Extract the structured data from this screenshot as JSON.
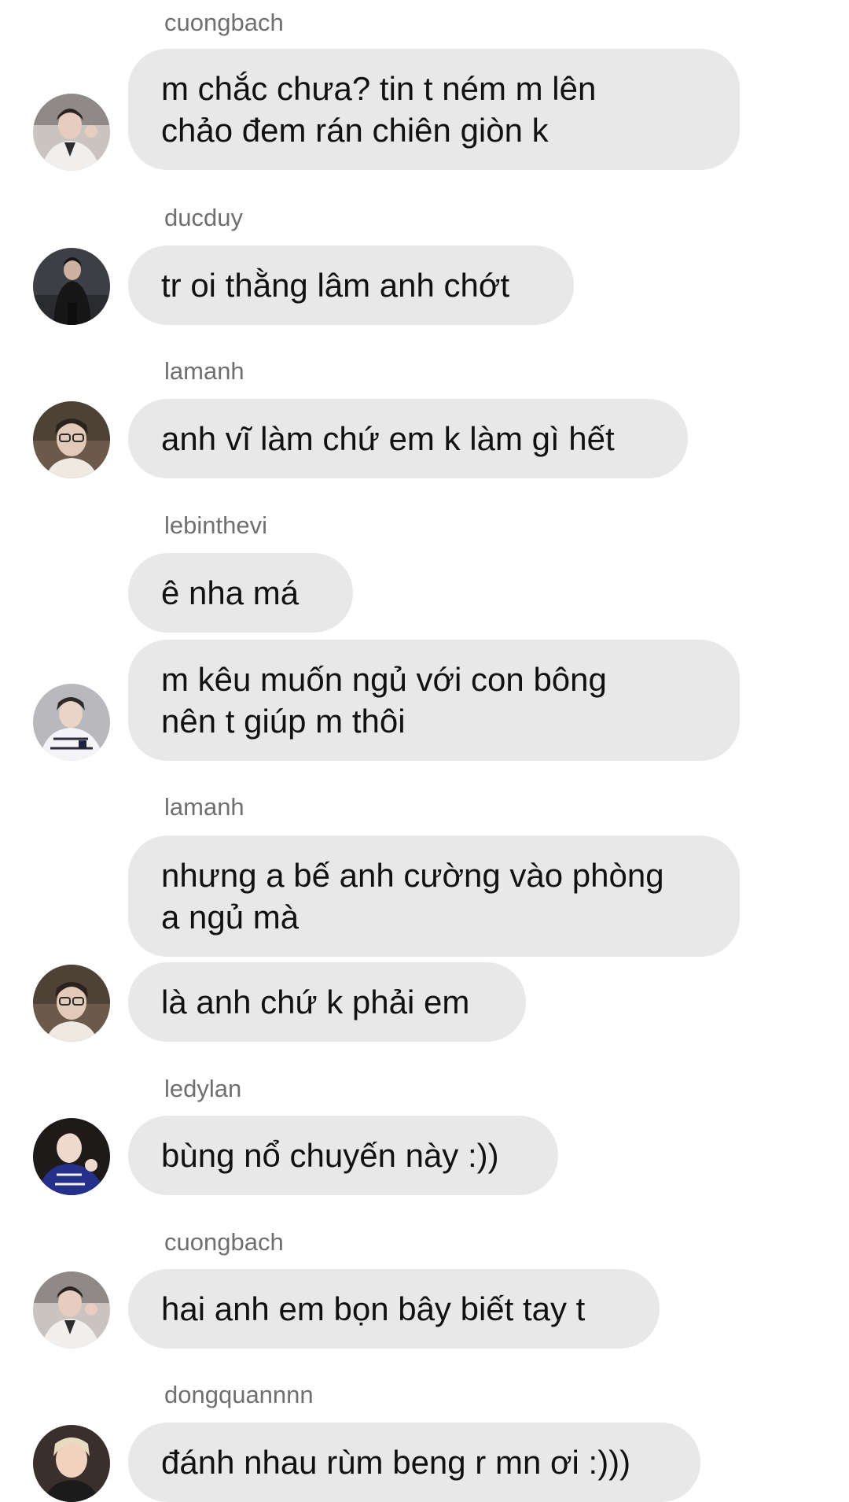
{
  "messages": [
    {
      "sender": "cuongbach",
      "text": "m chắc chưa? tin t ném m lên\nchảo đem rán chiên giòn k"
    },
    {
      "sender": "ducduy",
      "text": "tr oi thằng lâm anh chớt"
    },
    {
      "sender": "lamanh",
      "text": "anh vĩ làm chứ em k làm gì hết"
    },
    {
      "sender": "lebinthevi",
      "text": "ê nha má"
    },
    {
      "text": "m kêu muốn ngủ với con bông\nnên t giúp m thôi"
    },
    {
      "sender": "lamanh",
      "text": "nhưng a bế anh cường vào phòng\na ngủ mà"
    },
    {
      "text": "là anh chứ k phải em"
    },
    {
      "sender": "ledylan",
      "text": "bùng nổ chuyến này :))"
    },
    {
      "sender": "cuongbach",
      "text": "hai anh em bọn bây biết tay t"
    },
    {
      "sender": "dongquannnn",
      "text": "đánh nhau rùm beng r mn ơi :)))"
    }
  ],
  "avatars": [
    {
      "user": "cuongbach",
      "icon": "user-avatar-photo"
    },
    {
      "user": "ducduy",
      "icon": "user-avatar-photo"
    },
    {
      "user": "lamanh",
      "icon": "user-avatar-photo"
    },
    {
      "user": "lebinthevi",
      "icon": "user-avatar-photo"
    },
    {
      "user": "lamanh",
      "icon": "user-avatar-photo"
    },
    {
      "user": "ledylan",
      "icon": "user-avatar-photo"
    },
    {
      "user": "cuongbach",
      "icon": "user-avatar-photo"
    },
    {
      "user": "dongquannnn",
      "icon": "user-avatar-photo"
    }
  ],
  "colors": {
    "bubble": "#e8e8e8",
    "sender_text": "#6f6f6f",
    "message_text": "#111111",
    "background": "#ffffff"
  }
}
